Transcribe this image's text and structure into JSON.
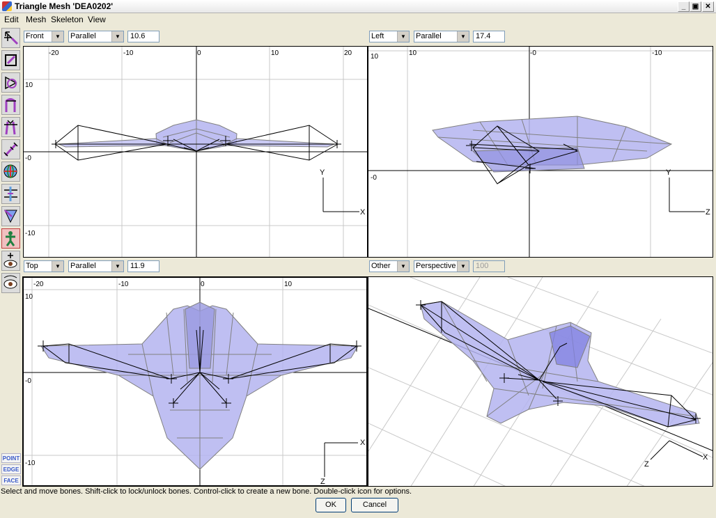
{
  "window": {
    "title": "Triangle Mesh 'DEA0202'",
    "minimize": "_",
    "maximize": "▣",
    "close": "✕"
  },
  "menu": [
    "Edit",
    "Mesh",
    "Skeleton",
    "View"
  ],
  "tools": [
    "move-bones-icon",
    "select-vertices-icon",
    "rotate-bone-icon",
    "bend-bone-icon",
    "scale-bone-icon",
    "stretch-bone-icon",
    "globe-icon",
    "align-bones-icon",
    "triangle-select-icon",
    "skeleton-figure-icon",
    "pan-view-icon",
    "orbit-view-icon"
  ],
  "modes": [
    "POINT",
    "EDGE",
    "FACE"
  ],
  "viewports": [
    {
      "view": "Front",
      "projection": "Parallel",
      "zoom": "10.6",
      "xticks": [
        "-20",
        "-10",
        "0",
        "10",
        "20"
      ],
      "yticks": [
        "10",
        "-0",
        "-10"
      ],
      "axis_h": "X",
      "axis_v": "Y"
    },
    {
      "view": "Left",
      "projection": "Parallel",
      "zoom": "17.4",
      "xticks": [
        "10",
        "-0",
        "-10"
      ],
      "yticks": [
        "10",
        "-0"
      ],
      "axis_h": "Z",
      "axis_v": "Y"
    },
    {
      "view": "Top",
      "projection": "Parallel",
      "zoom": "11.9",
      "xticks": [
        "-20",
        "-10",
        "0",
        "10"
      ],
      "yticks": [
        "10",
        "-0",
        "-10"
      ],
      "axis_h": "X",
      "axis_v": "Z"
    },
    {
      "view": "Other",
      "projection": "Perspective",
      "zoom": "100",
      "axis_h": "X",
      "axis_v": "Z"
    }
  ],
  "status": "Select and move bones.  Shift-click to lock/unlock bones.  Control-click to create a new bone.  Double-click icon for options.",
  "buttons": {
    "ok": "OK",
    "cancel": "Cancel"
  },
  "colors": {
    "mesh_fill": "#b4b4f0",
    "mesh_edge": "#808080",
    "bone": "#000000",
    "grid": "#c8c8c8"
  }
}
